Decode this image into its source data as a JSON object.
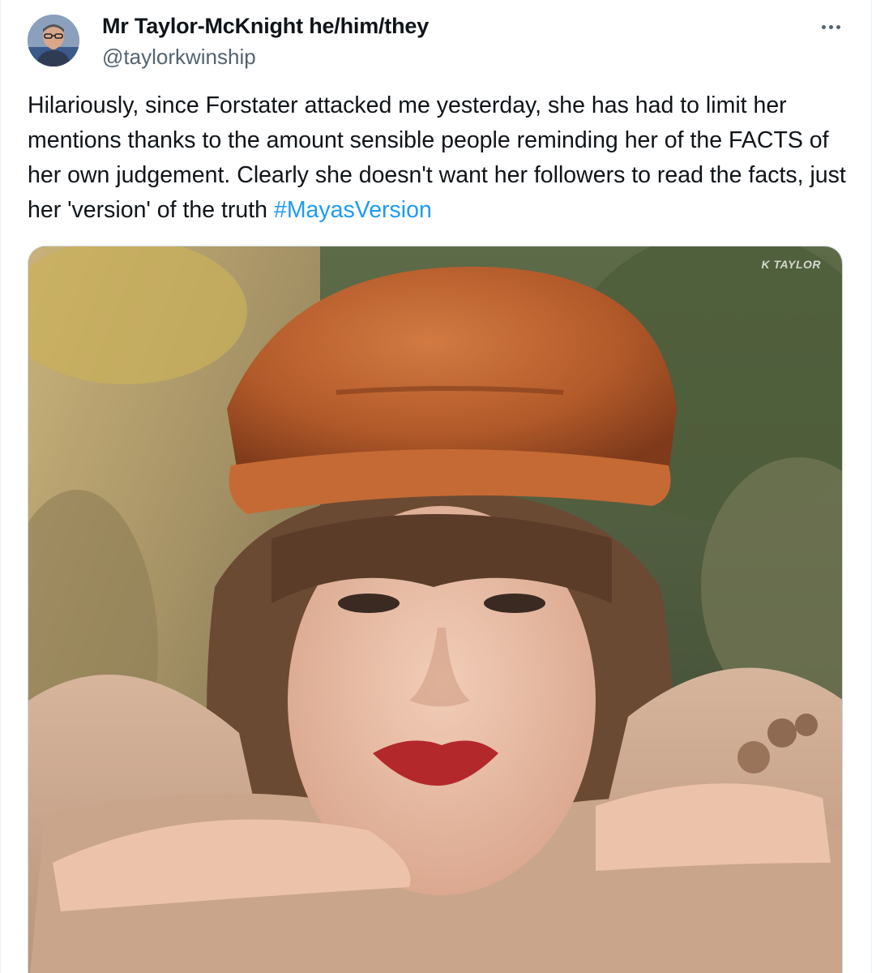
{
  "author": {
    "display_name": "Mr Taylor-McKnight he/him/they",
    "handle": "@taylorkwinship"
  },
  "tweet": {
    "text": "Hilariously, since Forstater attacked me yesterday, she has had to limit her mentions thanks to the amount sensible people reminding her of the FACTS of her own judgement. Clearly she doesn't want her followers to read the facts, just her 'version' of the truth ",
    "hashtag": "#MayasVersion"
  },
  "media": {
    "watermark": "K TAYLOR"
  },
  "icons": {
    "more": "more-dots-icon",
    "avatar": "profile-photo"
  },
  "colors": {
    "link": "#1d9bf0",
    "secondary_text": "#536471",
    "primary_text": "#0f1419",
    "border": "#cfd9de"
  }
}
